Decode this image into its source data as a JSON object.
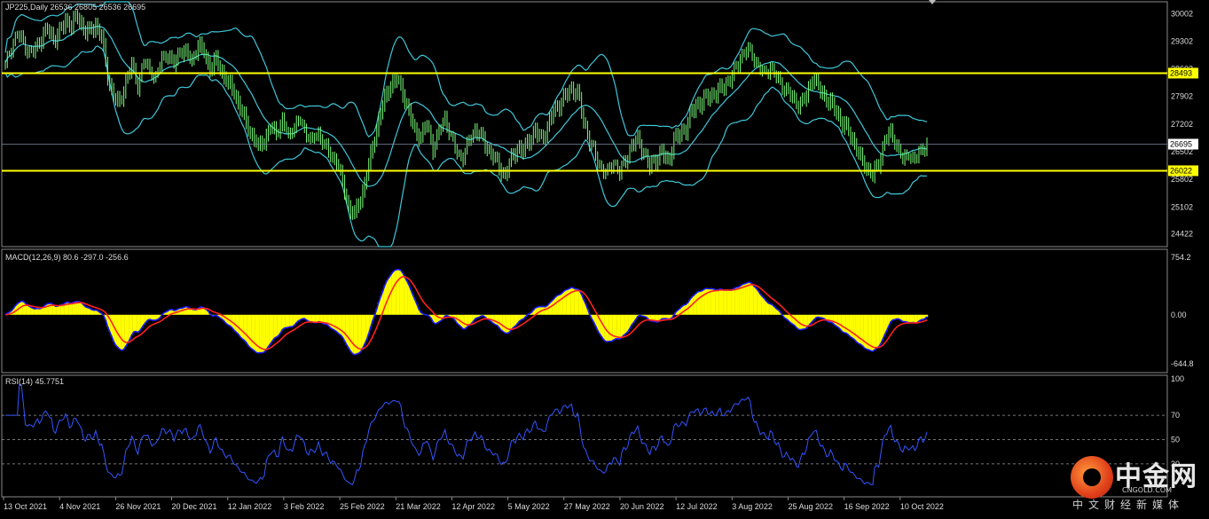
{
  "panels": {
    "price_label": "JP225,Daily  26536 26805 26536 26695",
    "macd_label": "MACD(12,26,9) 80.6 -297.0 -256.6",
    "rsi_label": "RSI(14) 45.7751"
  },
  "watermark": {
    "name": "中金网",
    "domain": "CNGOLD.COM",
    "slogan": "中文财经新媒体"
  },
  "colors": {
    "background": "#000000",
    "candle": "#7CFC7C",
    "bollinger": "#3fc6d8",
    "support_resistance": "#ffff00",
    "macd_hist": "#ffff00",
    "macd_line": "#1a1aff",
    "signal_line": "#ff2020",
    "rsi_line": "#3355ff",
    "axis_text": "#dcdcdc"
  },
  "chart_data": [
    {
      "type": "candlestick",
      "symbol": "JP225",
      "timeframe": "Daily",
      "ylim": [
        24100,
        30300
      ],
      "y_ticks": [
        30002,
        29302,
        28602,
        27902,
        27202,
        26502,
        25802,
        25102,
        24422
      ],
      "x_ticks": [
        "13 Oct 2021",
        "4 Nov 2021",
        "26 Nov 2021",
        "20 Dec 2021",
        "12 Jan 2022",
        "3 Feb 2022",
        "25 Feb 2022",
        "21 Mar 2022",
        "12 Apr 2022",
        "5 May 2022",
        "27 May 2022",
        "20 Jun 2022",
        "12 Jul 2022",
        "3 Aug 2022",
        "25 Aug 2022",
        "16 Sep 2022",
        "10 Oct 2022"
      ],
      "horizontal_lines": [
        {
          "value": 28493,
          "label": "28493"
        },
        {
          "value": 26022,
          "label": "26022"
        }
      ],
      "current_price": {
        "value": 26695,
        "label": "26695"
      },
      "series": [
        {
          "name": "Bollinger Bands",
          "lines": [
            "upper",
            "middle",
            "lower"
          ]
        }
      ],
      "closes_approx": [
        [
          0,
          28700
        ],
        [
          3,
          29200
        ],
        [
          6,
          29500
        ],
        [
          9,
          29300
        ],
        [
          12,
          29000
        ],
        [
          15,
          29100
        ],
        [
          18,
          29400
        ],
        [
          21,
          29600
        ],
        [
          24,
          29350
        ],
        [
          27,
          29500
        ],
        [
          30,
          29800
        ],
        [
          33,
          29700
        ],
        [
          36,
          29900
        ],
        [
          39,
          29600
        ],
        [
          42,
          29500
        ],
        [
          45,
          29700
        ],
        [
          48,
          29400
        ],
        [
          51,
          28400
        ],
        [
          54,
          27900
        ],
        [
          57,
          27700
        ],
        [
          60,
          28300
        ],
        [
          63,
          28700
        ],
        [
          66,
          28200
        ],
        [
          69,
          28800
        ],
        [
          72,
          28600
        ],
        [
          75,
          28400
        ],
        [
          78,
          28900
        ],
        [
          81,
          29000
        ],
        [
          84,
          28700
        ],
        [
          87,
          29100
        ],
        [
          90,
          29000
        ],
        [
          93,
          28800
        ],
        [
          96,
          29200
        ],
        [
          99,
          29000
        ],
        [
          102,
          28600
        ],
        [
          105,
          28800
        ],
        [
          108,
          28500
        ],
        [
          111,
          28200
        ],
        [
          114,
          28000
        ],
        [
          117,
          27600
        ],
        [
          120,
          27200
        ],
        [
          123,
          26900
        ],
        [
          126,
          26600
        ],
        [
          129,
          26800
        ],
        [
          132,
          27100
        ],
        [
          135,
          27000
        ],
        [
          138,
          27300
        ],
        [
          141,
          26900
        ],
        [
          144,
          27200
        ],
        [
          147,
          27300
        ],
        [
          150,
          27000
        ],
        [
          153,
          26800
        ],
        [
          156,
          27000
        ],
        [
          159,
          26700
        ],
        [
          162,
          26400
        ],
        [
          165,
          26300
        ],
        [
          168,
          25700
        ],
        [
          171,
          25100
        ],
        [
          174,
          24900
        ],
        [
          177,
          25300
        ],
        [
          180,
          25900
        ],
        [
          183,
          26600
        ],
        [
          186,
          27300
        ],
        [
          189,
          27800
        ],
        [
          192,
          28200
        ],
        [
          195,
          28300
        ],
        [
          198,
          28000
        ],
        [
          201,
          27500
        ],
        [
          204,
          27000
        ],
        [
          207,
          26900
        ],
        [
          210,
          27200
        ],
        [
          213,
          26600
        ],
        [
          216,
          27000
        ],
        [
          219,
          27400
        ],
        [
          222,
          26900
        ],
        [
          225,
          26500
        ],
        [
          228,
          26400
        ],
        [
          231,
          26800
        ],
        [
          234,
          27100
        ],
        [
          237,
          26900
        ],
        [
          240,
          26600
        ],
        [
          243,
          26400
        ],
        [
          246,
          26100
        ],
        [
          249,
          25900
        ],
        [
          252,
          26300
        ],
        [
          255,
          26600
        ],
        [
          258,
          26500
        ],
        [
          261,
          26800
        ],
        [
          264,
          27000
        ],
        [
          267,
          26800
        ],
        [
          270,
          27100
        ],
        [
          273,
          27500
        ],
        [
          276,
          27700
        ],
        [
          279,
          27900
        ],
        [
          282,
          28100
        ],
        [
          285,
          28000
        ],
        [
          288,
          27300
        ],
        [
          291,
          26800
        ],
        [
          294,
          26400
        ],
        [
          297,
          26100
        ],
        [
          300,
          26000
        ],
        [
          303,
          26300
        ],
        [
          306,
          26000
        ],
        [
          309,
          26300
        ],
        [
          312,
          26700
        ],
        [
          315,
          26800
        ],
        [
          318,
          26500
        ],
        [
          321,
          26100
        ],
        [
          324,
          26300
        ],
        [
          327,
          26500
        ],
        [
          330,
          26200
        ],
        [
          333,
          26800
        ],
        [
          336,
          26900
        ],
        [
          339,
          27100
        ],
        [
          342,
          27500
        ],
        [
          345,
          27700
        ],
        [
          348,
          27800
        ],
        [
          351,
          27900
        ],
        [
          354,
          28000
        ],
        [
          357,
          28100
        ],
        [
          360,
          28300
        ],
        [
          363,
          28500
        ],
        [
          366,
          28900
        ],
        [
          369,
          29100
        ],
        [
          372,
          29000
        ],
        [
          375,
          28700
        ],
        [
          378,
          28500
        ],
        [
          381,
          28700
        ],
        [
          384,
          28400
        ],
        [
          387,
          28200
        ],
        [
          390,
          28000
        ],
        [
          393,
          27800
        ],
        [
          396,
          27700
        ],
        [
          399,
          27900
        ],
        [
          402,
          28400
        ],
        [
          405,
          28100
        ],
        [
          408,
          27900
        ],
        [
          411,
          27700
        ],
        [
          414,
          27500
        ],
        [
          417,
          27200
        ],
        [
          420,
          27000
        ],
        [
          423,
          26700
        ],
        [
          426,
          26300
        ],
        [
          429,
          26100
        ],
        [
          432,
          25900
        ],
        [
          435,
          26200
        ],
        [
          438,
          26800
        ],
        [
          441,
          27000
        ],
        [
          444,
          26700
        ],
        [
          447,
          26300
        ],
        [
          450,
          26500
        ],
        [
          453,
          26300
        ],
        [
          456,
          26600
        ],
        [
          459,
          26695
        ]
      ]
    },
    {
      "type": "macd",
      "params": "MACD(12,26,9)",
      "values": {
        "histogram": 80.6,
        "macd": -297.0,
        "signal": -256.6
      },
      "ylim": [
        -760,
        860
      ],
      "y_ticks": [
        754.2,
        0.0,
        -644.8
      ],
      "series": [
        {
          "name": "histogram",
          "kind": "bar"
        },
        {
          "name": "macd",
          "kind": "line"
        },
        {
          "name": "signal",
          "kind": "line"
        }
      ]
    },
    {
      "type": "line",
      "params": "RSI(14)",
      "value": 45.7751,
      "ylim": [
        0,
        100
      ],
      "y_ticks": [
        100,
        70,
        50,
        30
      ],
      "levels": [
        70,
        50,
        30
      ]
    }
  ]
}
